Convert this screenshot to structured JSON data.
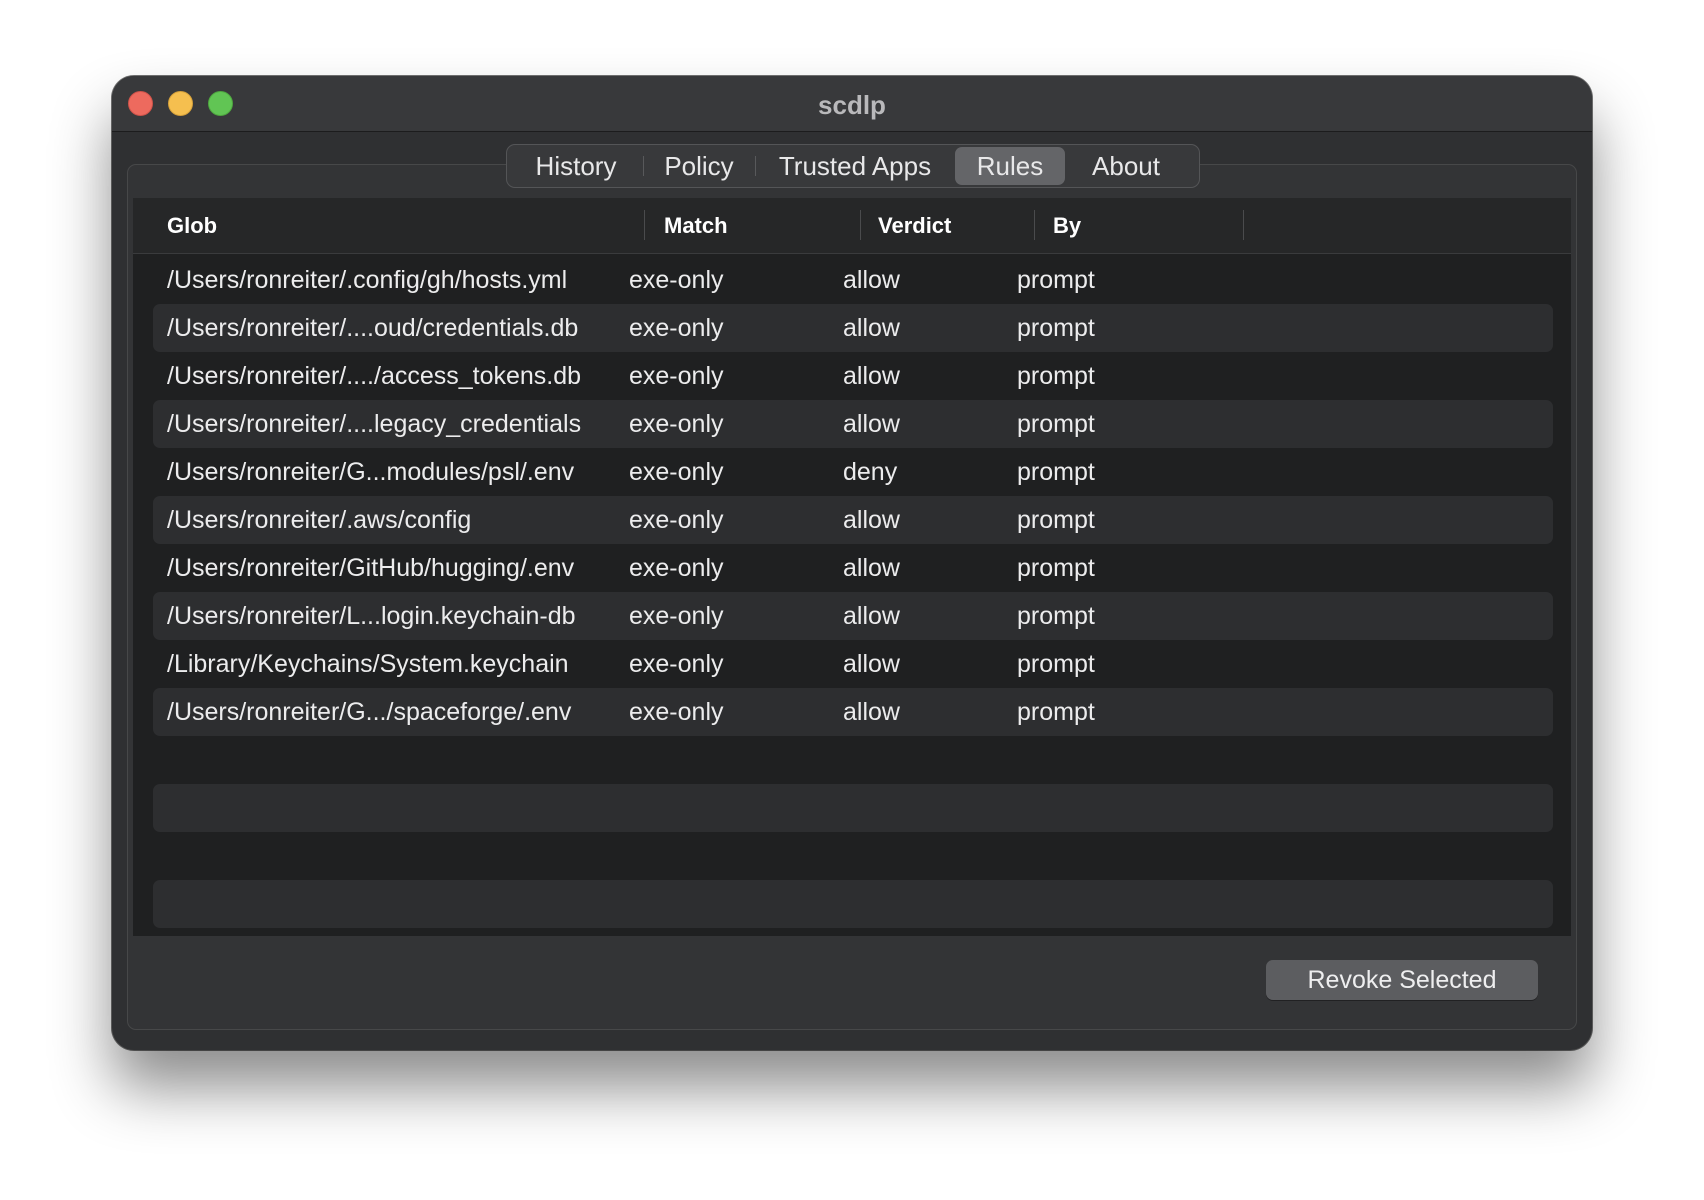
{
  "window": {
    "title": "scdlp"
  },
  "tabs": [
    {
      "label": "History",
      "selected": false
    },
    {
      "label": "Policy",
      "selected": false
    },
    {
      "label": "Trusted Apps",
      "selected": false
    },
    {
      "label": "Rules",
      "selected": true
    },
    {
      "label": "About",
      "selected": false
    }
  ],
  "table": {
    "columns": [
      "Glob",
      "Match",
      "Verdict",
      "By"
    ],
    "rows": [
      {
        "glob": "/Users/ronreiter/.config/gh/hosts.yml",
        "match": "exe-only",
        "verdict": "allow",
        "by": "prompt"
      },
      {
        "glob": "/Users/ronreiter/....oud/credentials.db",
        "match": "exe-only",
        "verdict": "allow",
        "by": "prompt"
      },
      {
        "glob": "/Users/ronreiter/..../access_tokens.db",
        "match": "exe-only",
        "verdict": "allow",
        "by": "prompt"
      },
      {
        "glob": "/Users/ronreiter/....legacy_credentials",
        "match": "exe-only",
        "verdict": "allow",
        "by": "prompt"
      },
      {
        "glob": "/Users/ronreiter/G...modules/psl/.env",
        "match": "exe-only",
        "verdict": "deny",
        "by": "prompt"
      },
      {
        "glob": "/Users/ronreiter/.aws/config",
        "match": "exe-only",
        "verdict": "allow",
        "by": "prompt"
      },
      {
        "glob": "/Users/ronreiter/GitHub/hugging/.env",
        "match": "exe-only",
        "verdict": "allow",
        "by": "prompt"
      },
      {
        "glob": "/Users/ronreiter/L...login.keychain-db",
        "match": "exe-only",
        "verdict": "allow",
        "by": "prompt"
      },
      {
        "glob": "/Library/Keychains/System.keychain",
        "match": "exe-only",
        "verdict": "allow",
        "by": "prompt"
      },
      {
        "glob": "/Users/ronreiter/G.../spaceforge/.env",
        "match": "exe-only",
        "verdict": "allow",
        "by": "prompt"
      }
    ]
  },
  "actions": {
    "revoke_label": "Revoke Selected"
  },
  "colors": {
    "window_bg": "#2f3032",
    "table_bg": "#1f2021",
    "row_alt": "#2d2e30",
    "selected_tab": "#646568",
    "traffic_close": "#ed6a5e",
    "traffic_minimize": "#f5bf4f",
    "traffic_zoom": "#61c554"
  }
}
